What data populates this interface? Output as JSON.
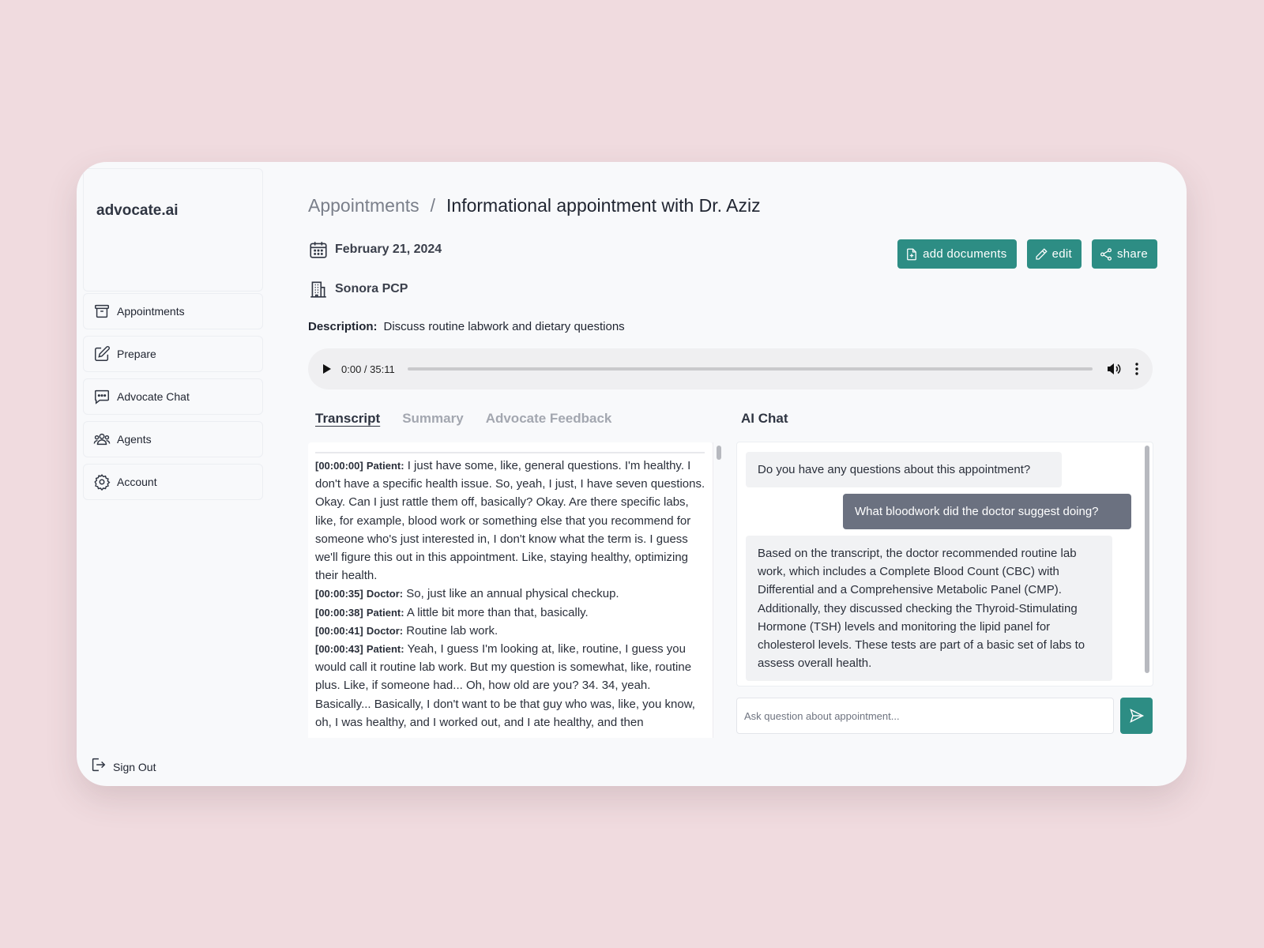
{
  "sidebar": {
    "brand": "advocate.ai",
    "items": [
      {
        "label": "Appointments",
        "icon": "archive-icon"
      },
      {
        "label": "Prepare",
        "icon": "pencil-square-icon"
      },
      {
        "label": "Advocate Chat",
        "icon": "chat-bubble-icon"
      },
      {
        "label": "Agents",
        "icon": "users-icon"
      },
      {
        "label": "Account",
        "icon": "gear-icon"
      }
    ],
    "sign_out": "Sign Out"
  },
  "breadcrumb": {
    "parent": "Appointments",
    "separator": "/",
    "current": "Informational appointment with Dr. Aziz"
  },
  "appointment": {
    "date": "February 21, 2024",
    "location": "Sonora PCP",
    "description_label": "Description:",
    "description": "Discuss routine labwork and dietary questions"
  },
  "actions": {
    "add_documents": "add documents",
    "edit": "edit",
    "share": "share"
  },
  "audio": {
    "time": "0:00 / 35:11",
    "progress": 0
  },
  "tabs": [
    {
      "label": "Transcript",
      "active": true
    },
    {
      "label": "Summary",
      "active": false
    },
    {
      "label": "Advocate Feedback",
      "active": false
    }
  ],
  "transcript": [
    {
      "ts": "[00:00:00]",
      "speaker": "Patient:",
      "text": "I just have some, like, general questions. I'm healthy. I don't have a specific health issue. So, yeah, I just, I have seven questions. Okay. Can I just rattle them off, basically? Okay. Are there specific labs, like, for example, blood work or something else that you recommend for someone who's just interested in, I don't know what the term is. I guess we'll figure this out in this appointment. Like, staying healthy, optimizing their health."
    },
    {
      "ts": "[00:00:35]",
      "speaker": "Doctor:",
      "text": "So, just like an annual physical checkup."
    },
    {
      "ts": "[00:00:38]",
      "speaker": "Patient:",
      "text": "A little bit more than that, basically."
    },
    {
      "ts": "[00:00:41]",
      "speaker": "Doctor:",
      "text": "Routine lab work."
    },
    {
      "ts": "[00:00:43]",
      "speaker": "Patient:",
      "text": "Yeah, I guess I'm looking at, like, routine, I guess you would call it routine lab work. But my question is somewhat, like, routine plus. Like, if someone had... Oh, how old are you? 34. 34, yeah. Basically... Basically, I don't want to be that guy who was, like, you know, oh, I was healthy, and I worked out, and I ate healthy, and then"
    }
  ],
  "chat": {
    "title": "AI Chat",
    "messages": [
      {
        "role": "ai",
        "text": "Do you have any questions about this appointment?"
      },
      {
        "role": "user",
        "text": "What bloodwork did the doctor suggest doing?"
      },
      {
        "role": "ai",
        "text": "Based on the transcript, the doctor recommended routine lab work, which includes a Complete Blood Count (CBC) with Differential and a Comprehensive Metabolic Panel (CMP). Additionally, they discussed checking the Thyroid-Stimulating Hormone (TSH) levels and monitoring the lipid panel for cholesterol levels. These tests are part of a basic set of labs to assess overall health."
      }
    ],
    "input_placeholder": "Ask question about appointment..."
  },
  "colors": {
    "background": "#f0dbdf",
    "accent": "#2d8d84",
    "user_bubble": "#6b7180"
  }
}
